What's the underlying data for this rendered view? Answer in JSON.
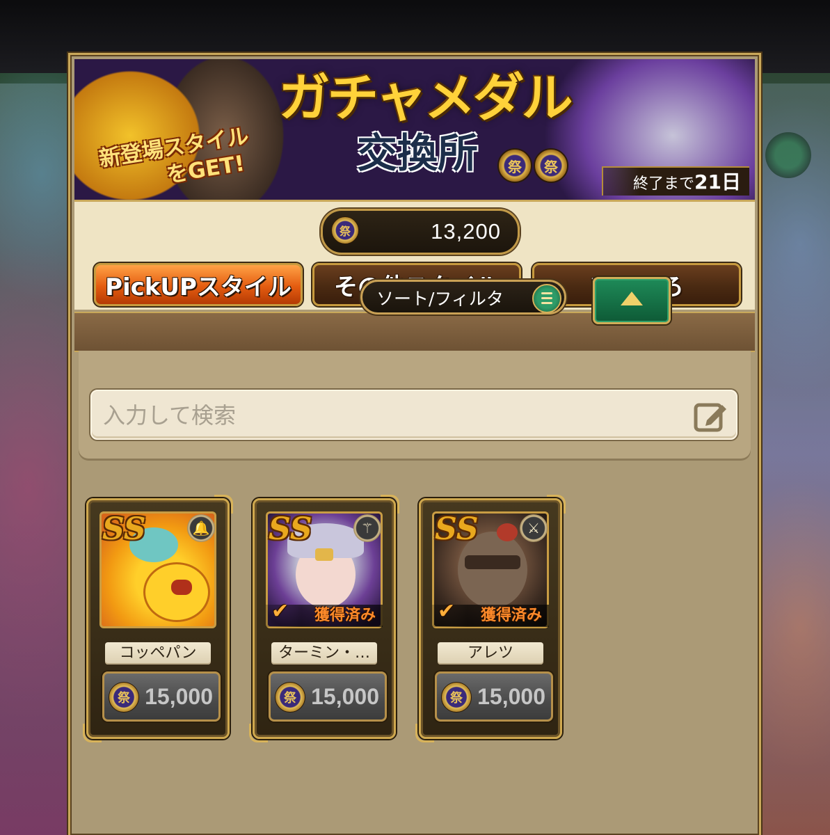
{
  "banner": {
    "title": "ガチャメダル",
    "subtitle": "交換所",
    "tag_line1": "新登場スタイル",
    "tag_line2": "をGET!",
    "countdown_prefix": "終了まで",
    "countdown_value": "21日",
    "medal_glyph": "祭"
  },
  "currency": {
    "icon": "festival-medal-icon",
    "value": "13,200"
  },
  "tabs": [
    {
      "label": "PickUPスタイル",
      "active": true
    },
    {
      "label": "その他スタイル",
      "active": false
    },
    {
      "label": "いろいろ",
      "active": false
    }
  ],
  "sort": {
    "label": "ソート/フィルタ"
  },
  "search": {
    "placeholder": "入力して検索"
  },
  "cards": [
    {
      "name": "コッペパン",
      "rank": "SS",
      "price": "15,000",
      "acquired": false,
      "weapon_icon": "bell-icon"
    },
    {
      "name": "ターミン・…",
      "rank": "SS",
      "price": "15,000",
      "acquired": true,
      "acquired_label": "獲得済み",
      "weapon_icon": "staff-icon"
    },
    {
      "name": "アレツ",
      "rank": "SS",
      "price": "15,000",
      "acquired": true,
      "acquired_label": "獲得済み",
      "weapon_icon": "sword-icon"
    }
  ],
  "colors": {
    "panel": "#ab9a76",
    "tab_active": "#e45c10",
    "gold_border": "#c9a85a",
    "accent_green": "#1e8a58"
  }
}
